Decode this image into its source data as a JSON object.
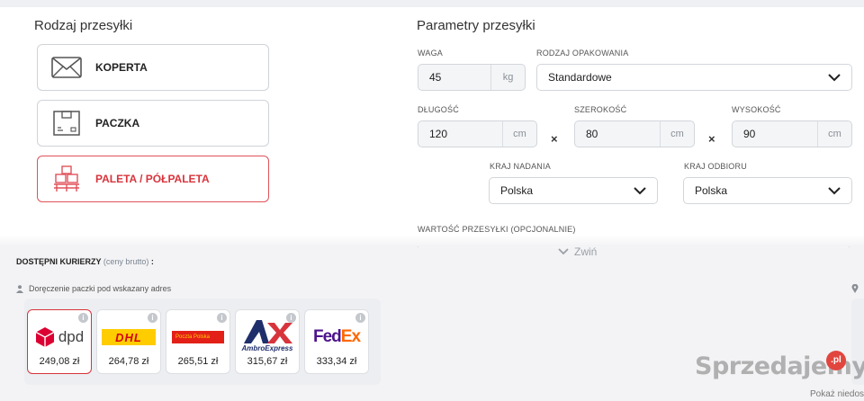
{
  "left": {
    "title": "Rodzaj przesyłki",
    "types": [
      {
        "label": "KOPERTA",
        "icon": "envelope-icon",
        "selected": false
      },
      {
        "label": "PACZKA",
        "icon": "box-icon",
        "selected": false
      },
      {
        "label": "PALETA / PÓŁPALETA",
        "icon": "pallet-icon",
        "selected": true
      }
    ]
  },
  "params": {
    "title": "Parametry przesyłki",
    "weight_label": "WAGA",
    "weight_value": "45",
    "weight_unit": "kg",
    "packaging_label": "RODZAJ OPAKOWANIA",
    "packaging_value": "Standardowe",
    "length_label": "DŁUGOŚĆ",
    "length_value": "120",
    "width_label": "SZEROKOŚĆ",
    "width_value": "80",
    "height_label": "WYSOKOŚĆ",
    "height_value": "90",
    "dim_unit": "cm",
    "times": "×",
    "origin_label": "KRAJ NADANIA",
    "origin_value": "Polska",
    "dest_label": "KRAJ ODBIORU",
    "dest_value": "Polska",
    "value_label": "WARTOŚĆ PRZESYŁKI (OPCJONALNIE)"
  },
  "collapse_label": "Zwiń",
  "couriers": {
    "title": "DOSTĘPNI KURIERZY",
    "subtitle": "(ceny brutto)",
    "colon": ":",
    "delivery_label": "Doręczenie paczki pod wskazany adres",
    "items": [
      {
        "name": "dpd",
        "price": "249,08 zł",
        "selected": true
      },
      {
        "name": "DHL",
        "price": "264,78 zł",
        "selected": false
      },
      {
        "name": "Pocztex",
        "logo_text": "Poczta Polska",
        "price": "265,51 zł",
        "selected": false
      },
      {
        "name": "Ambro Express",
        "logo_text": "AmbroExpress",
        "price": "315,67 zł",
        "selected": false
      },
      {
        "name": "FedEx",
        "logo_text": "FedEx",
        "price": "333,34 zł",
        "selected": false
      }
    ]
  },
  "watermark": "Sprzedajemy",
  "watermark_badge": ".pl",
  "footer_link": "Pokaż niedost",
  "colors": {
    "accent": "#d8343c",
    "dhl_yellow": "#ffcc00",
    "fedex_purple": "#4d148c",
    "fedex_orange": "#ff6600",
    "ambro_navy": "#1f2f6b"
  }
}
